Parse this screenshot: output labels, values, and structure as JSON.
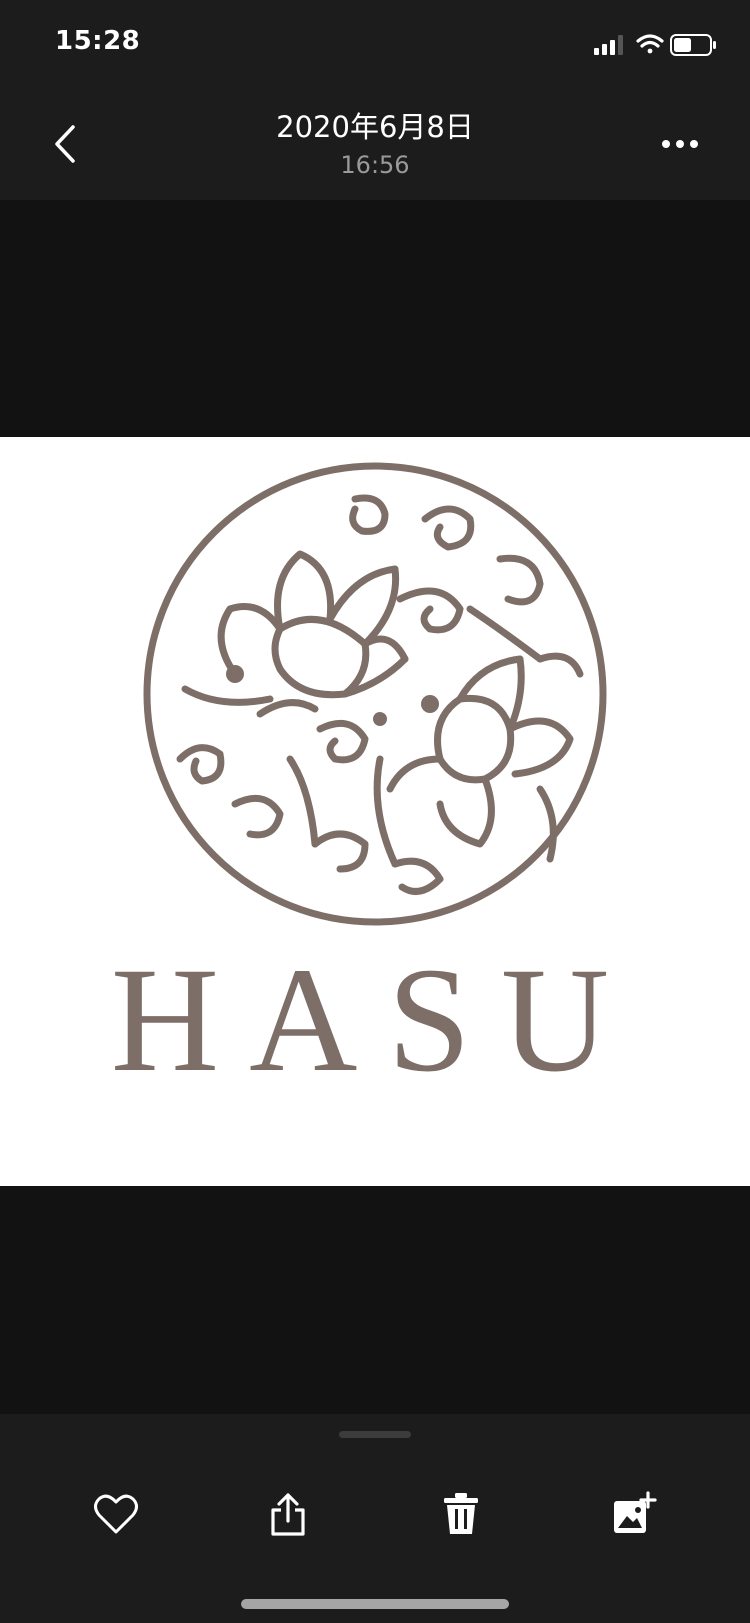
{
  "status_bar": {
    "time": "15:28",
    "icons": [
      "cellular-signal-icon",
      "wifi-icon",
      "battery-icon"
    ]
  },
  "header": {
    "title": "2020年6月8日",
    "subtitle": "16:56",
    "back_icon": "chevron-left-icon",
    "more_icon": "ellipsis-icon"
  },
  "photo": {
    "logo_text": "HASU",
    "logo_color": "#7d6f68",
    "background": "#ffffff"
  },
  "toolbar": {
    "items": [
      {
        "name": "favorite-button",
        "icon": "heart-icon"
      },
      {
        "name": "share-button",
        "icon": "share-icon"
      },
      {
        "name": "delete-button",
        "icon": "trash-icon"
      },
      {
        "name": "add-to-album-button",
        "icon": "add-photo-icon"
      }
    ]
  },
  "colors": {
    "bar_background": "#1c1c1c",
    "canvas_background": "#121212",
    "subtitle_text": "#9a9a9a"
  }
}
